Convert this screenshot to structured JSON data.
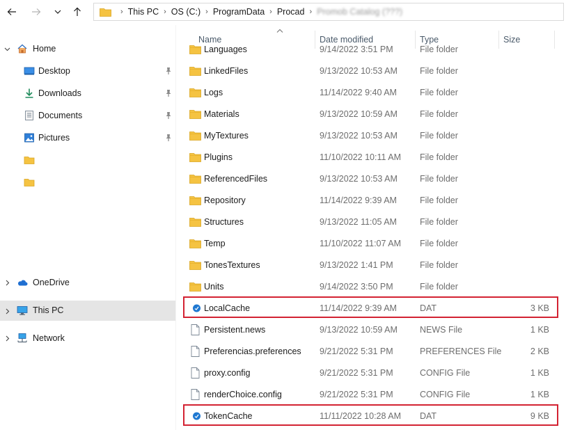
{
  "toolbar": {
    "back_icon": "arrow-left-icon",
    "forward_icon": "arrow-right-icon",
    "recent_icon": "chevron-down-icon",
    "up_icon": "arrow-up-icon"
  },
  "address": {
    "crumbs": [
      "This PC",
      "OS (C:)",
      "ProgramData",
      "Procad",
      "Promob Catalog (???)"
    ]
  },
  "nav": {
    "home": "Home",
    "desktop": "Desktop",
    "downloads": "Downloads",
    "documents": "Documents",
    "pictures": "Pictures",
    "onedrive": "OneDrive",
    "thispc": "This PC",
    "network": "Network"
  },
  "columns": {
    "name": "Name",
    "date": "Date modified",
    "type": "Type",
    "size": "Size"
  },
  "files": [
    {
      "name": "Languages",
      "date": "9/14/2022 3:51 PM",
      "type": "File folder",
      "size": "",
      "icon": "folder-icon"
    },
    {
      "name": "LinkedFiles",
      "date": "9/13/2022 10:53 AM",
      "type": "File folder",
      "size": "",
      "icon": "folder-icon"
    },
    {
      "name": "Logs",
      "date": "11/14/2022 9:40 AM",
      "type": "File folder",
      "size": "",
      "icon": "folder-icon"
    },
    {
      "name": "Materials",
      "date": "9/13/2022 10:59 AM",
      "type": "File folder",
      "size": "",
      "icon": "folder-icon"
    },
    {
      "name": "MyTextures",
      "date": "9/13/2022 10:53 AM",
      "type": "File folder",
      "size": "",
      "icon": "folder-icon"
    },
    {
      "name": "Plugins",
      "date": "11/10/2022 10:11 AM",
      "type": "File folder",
      "size": "",
      "icon": "folder-icon"
    },
    {
      "name": "ReferencedFiles",
      "date": "9/13/2022 10:53 AM",
      "type": "File folder",
      "size": "",
      "icon": "folder-icon"
    },
    {
      "name": "Repository",
      "date": "11/14/2022 9:39 AM",
      "type": "File folder",
      "size": "",
      "icon": "folder-icon"
    },
    {
      "name": "Structures",
      "date": "9/13/2022 11:05 AM",
      "type": "File folder",
      "size": "",
      "icon": "folder-icon"
    },
    {
      "name": "Temp",
      "date": "11/10/2022 11:07 AM",
      "type": "File folder",
      "size": "",
      "icon": "folder-icon"
    },
    {
      "name": "TonesTextures",
      "date": "9/13/2022 1:41 PM",
      "type": "File folder",
      "size": "",
      "icon": "folder-icon"
    },
    {
      "name": "Units",
      "date": "9/14/2022 3:50 PM",
      "type": "File folder",
      "size": "",
      "icon": "folder-icon"
    },
    {
      "name": "LocalCache",
      "date": "11/14/2022 9:39 AM",
      "type": "DAT",
      "size": "3 KB",
      "icon": "dat-file-icon"
    },
    {
      "name": "Persistent.news",
      "date": "9/13/2022 10:59 AM",
      "type": "NEWS File",
      "size": "1 KB",
      "icon": "file-icon"
    },
    {
      "name": "Preferencias.preferences",
      "date": "9/21/2022 5:31 PM",
      "type": "PREFERENCES File",
      "size": "2 KB",
      "icon": "file-icon"
    },
    {
      "name": "proxy.config",
      "date": "9/21/2022 5:31 PM",
      "type": "CONFIG File",
      "size": "1 KB",
      "icon": "file-icon"
    },
    {
      "name": "renderChoice.config",
      "date": "9/21/2022 5:31 PM",
      "type": "CONFIG File",
      "size": "1 KB",
      "icon": "file-icon"
    },
    {
      "name": "TokenCache",
      "date": "11/11/2022 10:28 AM",
      "type": "DAT",
      "size": "9 KB",
      "icon": "dat-file-icon"
    }
  ],
  "colors": {
    "highlight": "#d32232",
    "folder": "#f5c342",
    "selected_nav": "#e5e5e5"
  }
}
